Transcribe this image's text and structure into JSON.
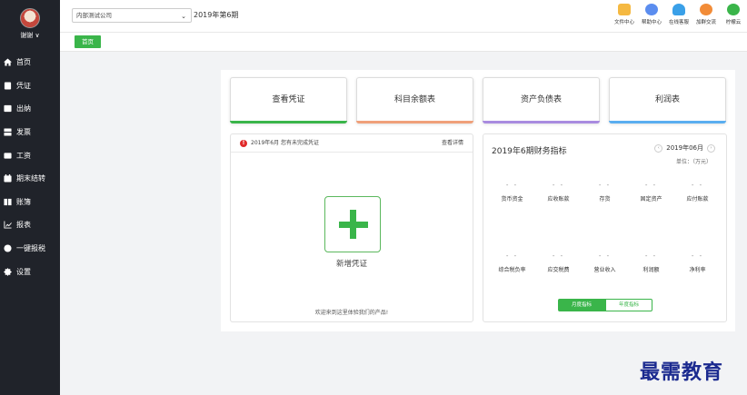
{
  "user": {
    "name": "谢谢 ∨"
  },
  "sidebar": {
    "items": [
      {
        "label": "首页",
        "icon": "home-icon"
      },
      {
        "label": "凭证",
        "icon": "voucher-icon"
      },
      {
        "label": "出纳",
        "icon": "cashier-icon"
      },
      {
        "label": "发票",
        "icon": "invoice-icon"
      },
      {
        "label": "工资",
        "icon": "salary-icon"
      },
      {
        "label": "期末结转",
        "icon": "period-end-icon"
      },
      {
        "label": "账簿",
        "icon": "ledger-icon"
      },
      {
        "label": "报表",
        "icon": "report-icon"
      },
      {
        "label": "一键报税",
        "icon": "tax-icon"
      },
      {
        "label": "设置",
        "icon": "settings-icon"
      }
    ]
  },
  "header": {
    "company": "内部测试公司",
    "period": "2019年第6期",
    "icons": [
      {
        "label": "文件中心",
        "icon": "folder-icon",
        "color": "#f5b942"
      },
      {
        "label": "帮助中心",
        "icon": "help-icon",
        "color": "#5b8def"
      },
      {
        "label": "在线客服",
        "icon": "service-icon",
        "color": "#3aa0e8"
      },
      {
        "label": "加群交流",
        "icon": "group-icon",
        "color": "#f28c38"
      },
      {
        "label": "柠檬云",
        "icon": "cloud-icon",
        "color": "#3ab54a"
      }
    ]
  },
  "tabs": {
    "home": "首页"
  },
  "cards": [
    {
      "label": "查看凭证",
      "color": "#3ab54a"
    },
    {
      "label": "科目余额表",
      "color": "#f0a07a"
    },
    {
      "label": "资产负债表",
      "color": "#a98be0"
    },
    {
      "label": "利润表",
      "color": "#5aaef0"
    }
  ],
  "voucher_panel": {
    "warning": "2019年6月 您有未完成凭证",
    "detail_link": "查看详情",
    "add_label": "新增凭证",
    "welcome": "欢迎来到这里体验我们的产品!"
  },
  "finance": {
    "title": "2019年6期财务指标",
    "month": "2019年06月",
    "prev": "‹",
    "next": "›",
    "unit": "单位：（万元）",
    "row1": [
      {
        "value": "- -",
        "name": "货币资金"
      },
      {
        "value": "- -",
        "name": "应收账款"
      },
      {
        "value": "- -",
        "name": "存货"
      },
      {
        "value": "- -",
        "name": "固定资产"
      },
      {
        "value": "- -",
        "name": "应付账款"
      }
    ],
    "row2": [
      {
        "value": "- -",
        "name": "综合税负率"
      },
      {
        "value": "- -",
        "name": "应交税费"
      },
      {
        "value": "- -",
        "name": "营业收入"
      },
      {
        "value": "- -",
        "name": "利润额"
      },
      {
        "value": "- -",
        "name": "净利率"
      }
    ],
    "toggle_month": "月度指标",
    "toggle_year": "年度指标"
  },
  "watermark": "最需教育"
}
